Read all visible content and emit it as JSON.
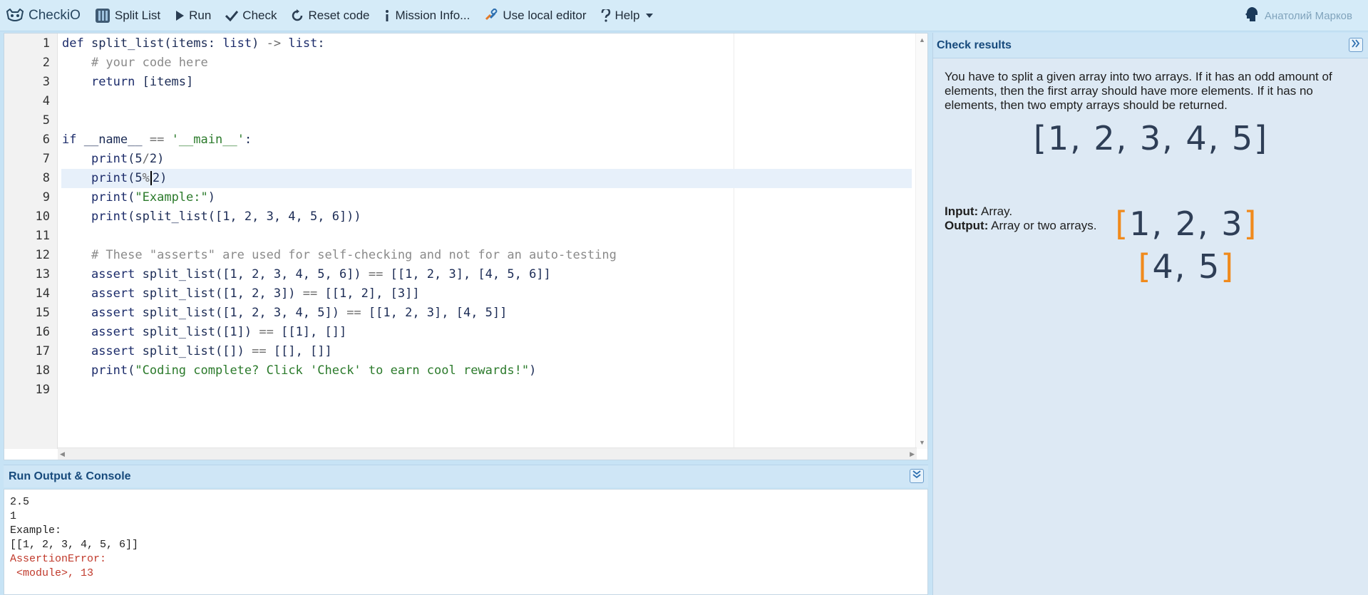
{
  "toolbar": {
    "logo": "CheckiO",
    "split_list": "Split List",
    "run": "Run",
    "check": "Check",
    "reset": "Reset code",
    "mission_info": "Mission Info...",
    "local_editor": "Use local editor",
    "help": "Help",
    "user": "Анатолий Марков"
  },
  "editor": {
    "lines": [
      {
        "n": "1",
        "code": "def split_list(items: list) -> list:"
      },
      {
        "n": "2",
        "code": "    # your code here"
      },
      {
        "n": "3",
        "code": "    return [items]"
      },
      {
        "n": "4",
        "code": ""
      },
      {
        "n": "5",
        "code": ""
      },
      {
        "n": "6",
        "code": "if __name__ == '__main__':"
      },
      {
        "n": "7",
        "code": "    print(5/2)"
      },
      {
        "n": "8",
        "code": "    print(5%2)"
      },
      {
        "n": "9",
        "code": "    print(\"Example:\")"
      },
      {
        "n": "10",
        "code": "    print(split_list([1, 2, 3, 4, 5, 6]))"
      },
      {
        "n": "11",
        "code": ""
      },
      {
        "n": "12",
        "code": "    # These \"asserts\" are used for self-checking and not for an auto-testing"
      },
      {
        "n": "13",
        "code": "    assert split_list([1, 2, 3, 4, 5, 6]) == [[1, 2, 3], [4, 5, 6]]"
      },
      {
        "n": "14",
        "code": "    assert split_list([1, 2, 3]) == [[1, 2], [3]]"
      },
      {
        "n": "15",
        "code": "    assert split_list([1, 2, 3, 4, 5]) == [[1, 2, 3], [4, 5]]"
      },
      {
        "n": "16",
        "code": "    assert split_list([1]) == [[1], []]"
      },
      {
        "n": "17",
        "code": "    assert split_list([]) == [[], []]"
      },
      {
        "n": "18",
        "code": "    print(\"Coding complete? Click 'Check' to earn cool rewards!\")"
      },
      {
        "n": "19",
        "code": ""
      }
    ]
  },
  "console": {
    "title": "Run Output & Console",
    "output": [
      {
        "text": "2.5",
        "error": false
      },
      {
        "text": "1",
        "error": false
      },
      {
        "text": "Example:",
        "error": false
      },
      {
        "text": "[[1, 2, 3, 4, 5, 6]]",
        "error": false
      },
      {
        "text": "AssertionError:",
        "error": true
      },
      {
        "text": " <module>, 13",
        "error": true
      }
    ]
  },
  "check_results": {
    "title": "Check results",
    "description": "You have to split a given array into two arrays. If it has an odd amount of elements, then the first array should have more elements. If it has no elements, then two empty arrays should be returned.",
    "array_full": "[1, 2, 3, 4, 5]",
    "array_left": "[1, 2, 3]",
    "array_right": "[4, 5]",
    "input_label": "Input:",
    "input_value": "Array.",
    "output_label": "Output:",
    "output_value": "Array or two arrays."
  },
  "colors": {
    "accent": "#174a7c",
    "bracket_orange": "#f08a1c",
    "error_red": "#c0392b"
  }
}
